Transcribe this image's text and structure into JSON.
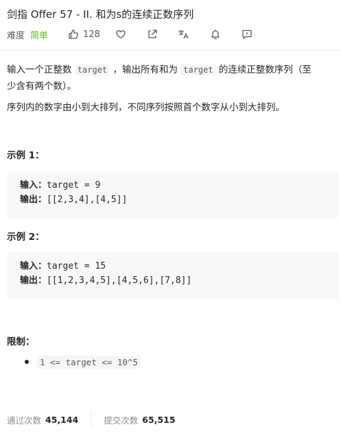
{
  "problem": {
    "title": "剑指 Offer 57 - II. 和为s的连续正数序列",
    "difficulty_label": "难度",
    "difficulty": "简单",
    "likes": "128",
    "colors": {
      "easy": "#5ab726",
      "text": "#262626",
      "muted": "#8c8c8c"
    }
  },
  "description": {
    "p1_a": "输入一个正整数 ",
    "p1_code1": "target",
    "p1_b": " ，输出所有和为 ",
    "p1_code2": "target",
    "p1_c": " 的连续正整数序列（至",
    "p1_line2": "少含有两个数）。",
    "p2": "序列内的数字由小到大排列，不同序列按照首个数字从小到大排列。"
  },
  "examples": [
    {
      "heading": "示例 1：",
      "input_label": "输入：",
      "input_value": "target = 9",
      "output_label": "输出：",
      "output_value": "[[2,3,4],[4,5]]"
    },
    {
      "heading": "示例 2：",
      "input_label": "输入：",
      "input_value": "target = 15",
      "output_label": "输出：",
      "output_value": "[[1,2,3,4,5],[4,5,6],[7,8]]"
    }
  ],
  "constraints": {
    "heading": "限制：",
    "items": [
      "1 <= target <= 10^5"
    ]
  },
  "stats": {
    "accepted_label": "通过次数",
    "accepted_value": "45,144",
    "submissions_label": "提交次数",
    "submissions_value": "65,515"
  },
  "icons": [
    "thumbs-up-icon",
    "heart-icon",
    "share-icon",
    "translate-icon",
    "bell-icon",
    "feedback-icon"
  ]
}
